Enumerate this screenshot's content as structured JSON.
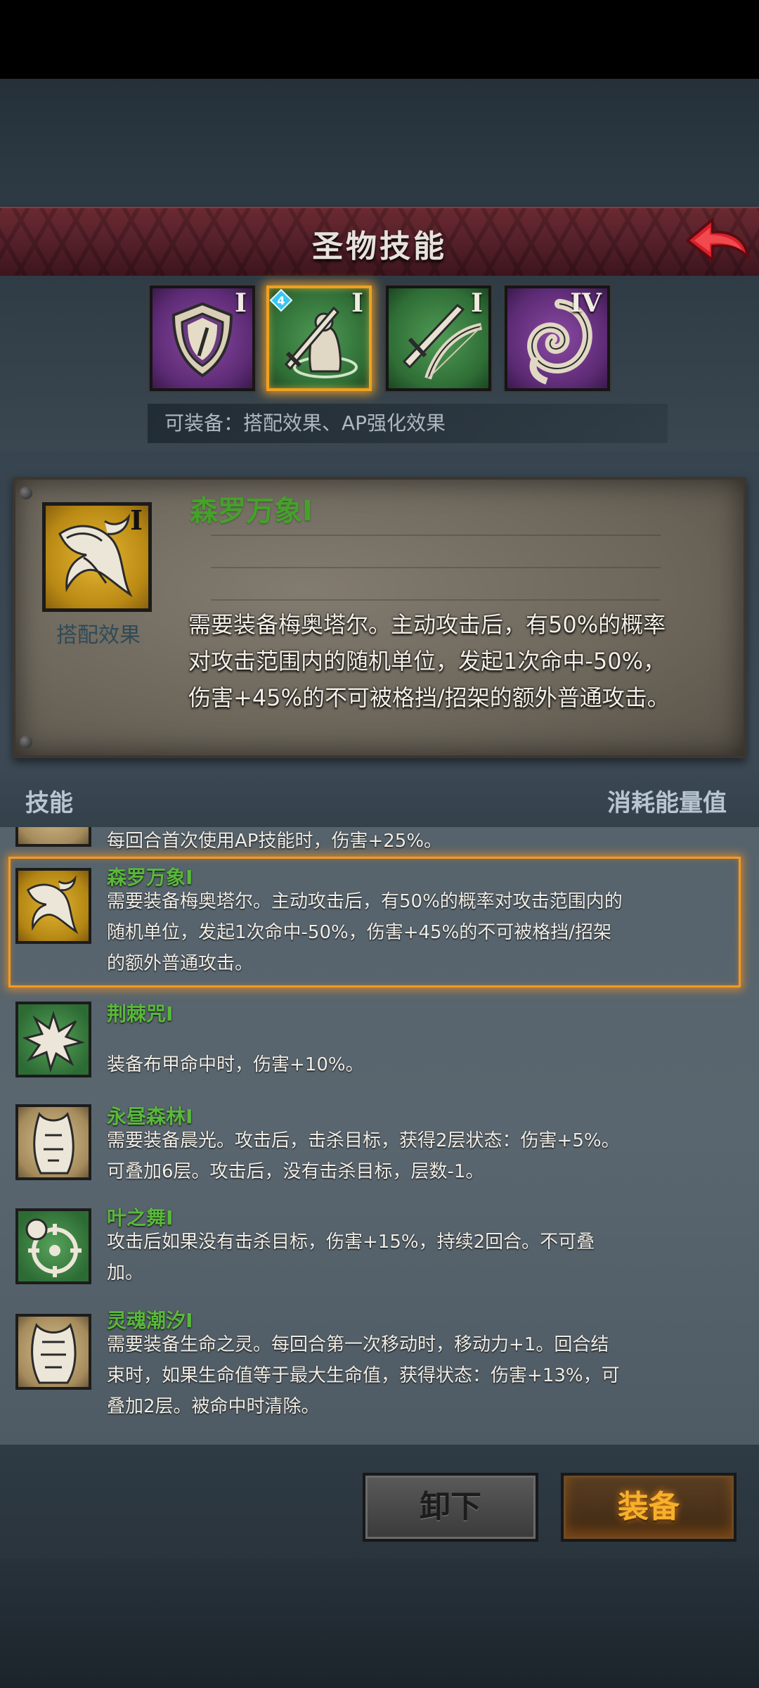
{
  "header": {
    "title": "圣物技能"
  },
  "tabs": [
    {
      "rank": "I",
      "icon": "shield-icon",
      "selected": false
    },
    {
      "rank": "I",
      "icon": "sword-relic-icon",
      "selected": true,
      "badge": "4"
    },
    {
      "rank": "I",
      "icon": "sword-bow-icon",
      "selected": false
    },
    {
      "rank": "IV",
      "icon": "spiral-icon",
      "selected": false
    }
  ],
  "equip_note": "可装备：搭配效果、AP强化效果",
  "detail": {
    "rank": "I",
    "icon_label": "搭配效果",
    "name": "森罗万象I",
    "description": "需要装备梅奥塔尔。主动攻击后，有50%的概率对攻击范围内的随机单位，发起1次命中-50%，伤害+45%的不可被格挡/招架的额外普通攻击。"
  },
  "list_header": {
    "left": "技能",
    "right": "消耗能量值"
  },
  "skills": [
    {
      "name": "",
      "desc": "每回合首次使用AP技能时，伤害+25%。"
    },
    {
      "name": "森罗万象I",
      "desc": "需要装备梅奥塔尔。主动攻击后，有50%的概率对攻击范围内的随机单位，发起1次命中-50%，伤害+45%的不可被格挡/招架的额外普通攻击。",
      "selected": true
    },
    {
      "name": "荆棘咒I",
      "desc": "装备布甲命中时，伤害+10%。"
    },
    {
      "name": "永昼森林I",
      "desc": "需要装备晨光。攻击后，击杀目标，获得2层状态：伤害+5%。可叠加6层。攻击后，没有击杀目标，层数-1。"
    },
    {
      "name": "叶之舞I",
      "desc": "攻击后如果没有击杀目标，伤害+15%，持续2回合。不可叠加。"
    },
    {
      "name": "灵魂潮汐I",
      "desc": "需要装备生命之灵。每回合第一次移动时，移动力+1。回合结束时，如果生命值等于最大生命值，获得状态：伤害+13%，可叠加2层。被命中时清除。"
    }
  ],
  "buttons": {
    "unequip": "卸下",
    "equip": "装备"
  }
}
